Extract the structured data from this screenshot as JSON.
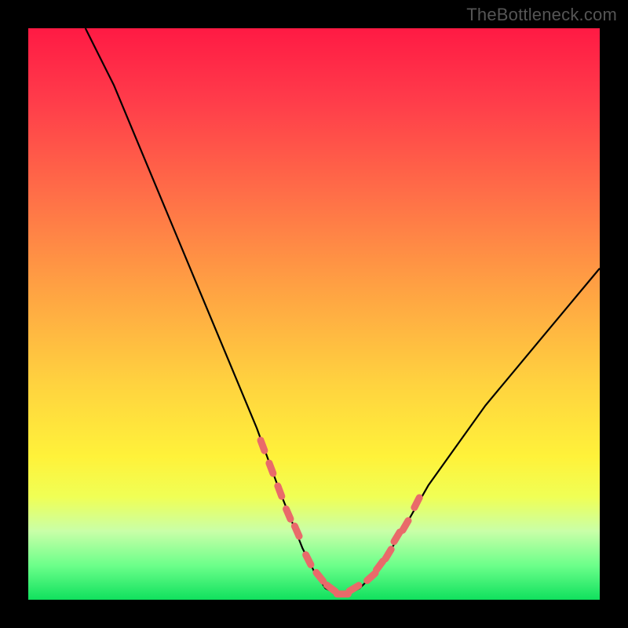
{
  "watermark": "TheBottleneck.com",
  "chart_data": {
    "type": "line",
    "title": "",
    "xlabel": "",
    "ylabel": "",
    "xlim": [
      0,
      100
    ],
    "ylim": [
      0,
      100
    ],
    "series": [
      {
        "name": "bottleneck-curve",
        "x": [
          10,
          15,
          20,
          25,
          30,
          35,
          40,
          44,
          46,
          48,
          50,
          52,
          54,
          56,
          58,
          60,
          63,
          66,
          70,
          75,
          80,
          85,
          90,
          95,
          100
        ],
        "y": [
          100,
          90,
          78,
          66,
          54,
          42,
          30,
          19,
          14,
          9,
          5,
          2,
          1,
          1,
          2,
          4,
          8,
          13,
          20,
          27,
          34,
          40,
          46,
          52,
          58
        ]
      }
    ],
    "markers": {
      "comment": "salmon-colored dots/segments overlaid on the curve near the trough",
      "color": "#e96a6a",
      "points_x": [
        41,
        42.5,
        44,
        45.5,
        47,
        49,
        51,
        53,
        55,
        57,
        60,
        61.5,
        63,
        64.5,
        66,
        68
      ],
      "points_y": [
        27,
        23,
        19,
        15,
        12,
        7,
        4,
        2,
        1,
        2,
        4,
        6,
        8,
        11,
        13,
        17
      ]
    },
    "background_gradient_stops": [
      {
        "pos": 0,
        "color": "#ff1a44"
      },
      {
        "pos": 12,
        "color": "#ff3a4a"
      },
      {
        "pos": 28,
        "color": "#ff6b48"
      },
      {
        "pos": 45,
        "color": "#ffa043"
      },
      {
        "pos": 62,
        "color": "#ffd23f"
      },
      {
        "pos": 75,
        "color": "#fff23a"
      },
      {
        "pos": 82,
        "color": "#f0ff55"
      },
      {
        "pos": 88,
        "color": "#c9ffa8"
      },
      {
        "pos": 94,
        "color": "#6cff8a"
      },
      {
        "pos": 100,
        "color": "#10e05e"
      }
    ]
  }
}
